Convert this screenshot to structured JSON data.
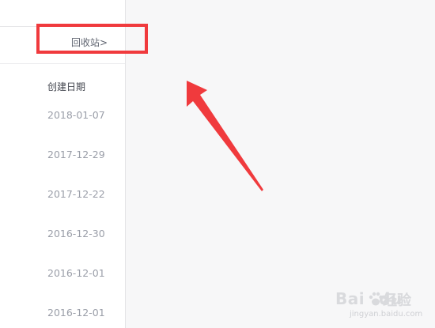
{
  "sidebar": {
    "recycle_label": "回收站>",
    "column_header": "创建日期",
    "dates": [
      "2018-01-07",
      "2017-12-29",
      "2017-12-22",
      "2016-12-30",
      "2016-12-01",
      "2016-12-01"
    ]
  },
  "annotation": {
    "highlight_color": "#f03a3d",
    "arrow_color": "#f03a3d"
  },
  "watermark": {
    "brand": "Bai",
    "brand_tail": "du",
    "sub": "经验",
    "url": "jingyan.baidu.com"
  }
}
